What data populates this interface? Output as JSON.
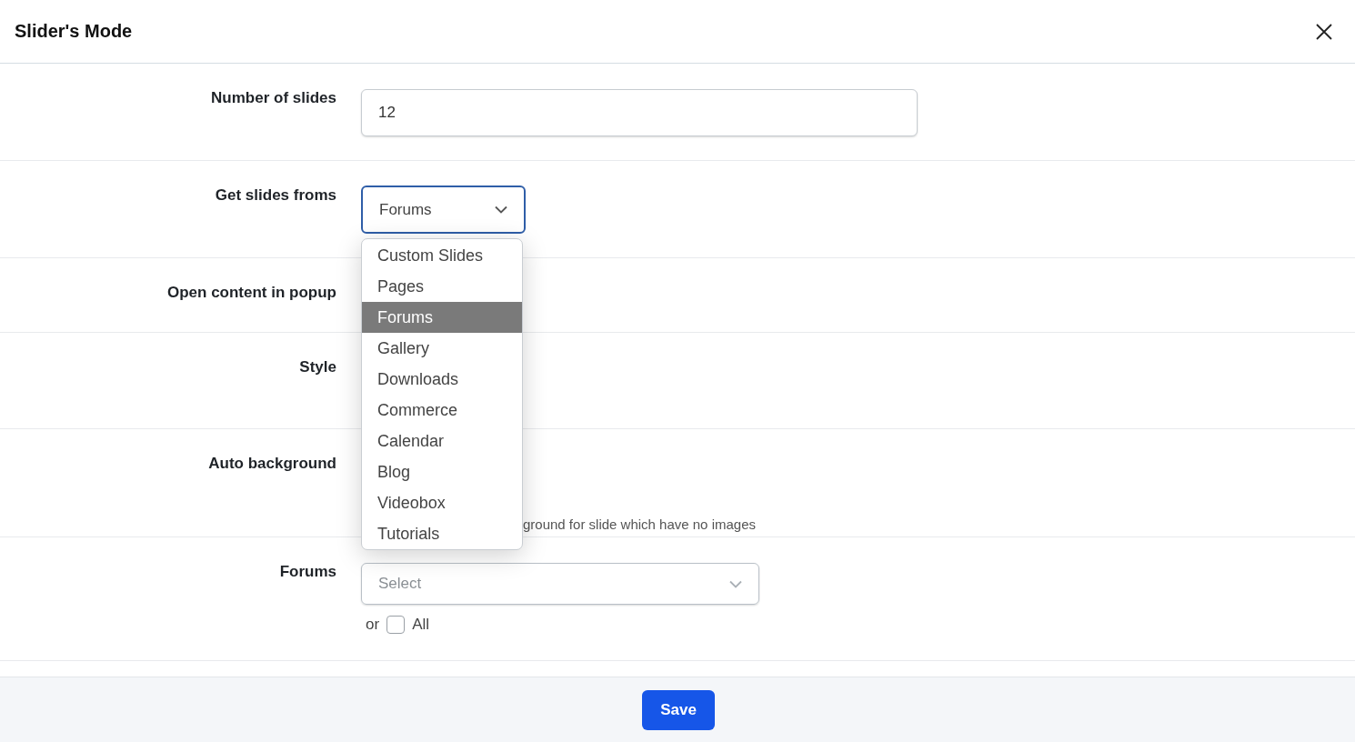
{
  "dialog": {
    "title": "Slider's Mode"
  },
  "fields": [
    {
      "kind": "text",
      "label": "Number of slides",
      "value": "12"
    },
    {
      "kind": "select",
      "label": "Get slides froms",
      "value": "Forums"
    },
    {
      "kind": "covered",
      "label": "Open content in popup"
    },
    {
      "kind": "covered",
      "label": "Style"
    },
    {
      "kind": "note",
      "label": "Auto background",
      "note": "ground for slide which have no images"
    },
    {
      "kind": "multiselect",
      "label": "Forums",
      "placeholder": "Select",
      "or_text": "or",
      "all_label": "All",
      "all_checked": false
    }
  ],
  "dropdown": {
    "options": [
      {
        "label": "Custom Slides",
        "selected": false
      },
      {
        "label": "Pages",
        "selected": false
      },
      {
        "label": "Forums",
        "selected": true
      },
      {
        "label": "Gallery",
        "selected": false
      },
      {
        "label": "Downloads",
        "selected": false
      },
      {
        "label": "Commerce",
        "selected": false
      },
      {
        "label": "Calendar",
        "selected": false
      },
      {
        "label": "Blog",
        "selected": false
      },
      {
        "label": "Videobox",
        "selected": false
      },
      {
        "label": "Tutorials",
        "selected": false
      }
    ]
  },
  "footer": {
    "save_label": "Save"
  }
}
